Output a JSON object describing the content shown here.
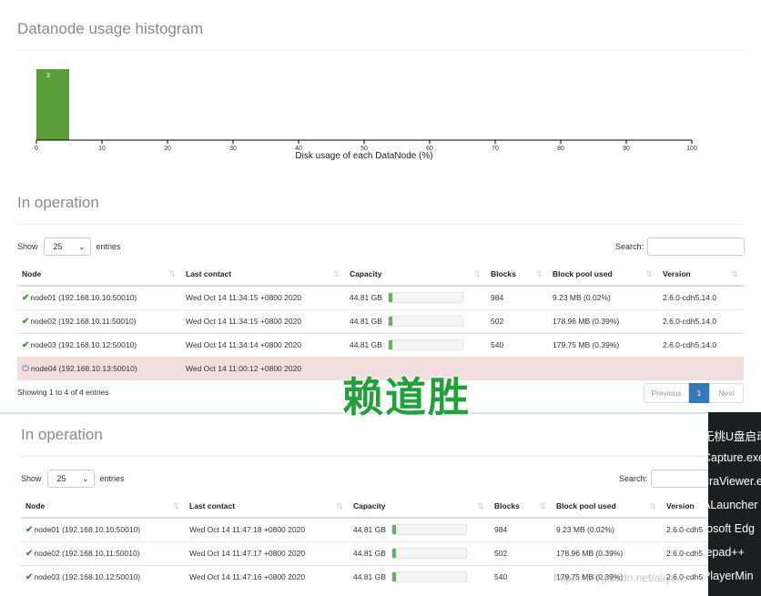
{
  "histogram": {
    "title": "Datanode usage histogram",
    "chart_data": {
      "type": "bar",
      "bins": [
        [
          0,
          5
        ]
      ],
      "values": [
        3
      ],
      "data_labels": [
        "3"
      ],
      "xlabel": "Disk usage of each DataNode (%)",
      "xlim": [
        0,
        100
      ],
      "xticks": [
        "0",
        "10",
        "20",
        "30",
        "40",
        "50",
        "60",
        "70",
        "80",
        "90",
        "100"
      ],
      "bar_color": "#5a9e3a"
    }
  },
  "section_a": {
    "title": "In operation",
    "show_label": "Show",
    "entries_value": "25",
    "entries_label": "entries",
    "search_label": "Search:",
    "columns": [
      "Node",
      "Last contact",
      "Capacity",
      "Blocks",
      "Block pool used",
      "Version"
    ],
    "rows": [
      {
        "node": "node01 (192.168.10.10:50010)",
        "contact": "Wed Oct 14 11:34:15 +0800 2020",
        "capacity": "44.81 GB",
        "used_fraction": 0.05,
        "blocks": "984",
        "pool": "9.23 MB (0.02%)",
        "version": "2.6.0-cdh5.14.0",
        "status": "ok"
      },
      {
        "node": "node02 (192.168.10.11:50010)",
        "contact": "Wed Oct 14 11:34:15 +0800 2020",
        "capacity": "44.81 GB",
        "used_fraction": 0.05,
        "blocks": "502",
        "pool": "178.96 MB (0.39%)",
        "version": "2.6.0-cdh5.14.0",
        "status": "ok"
      },
      {
        "node": "node03 (192.168.10.12:50010)",
        "contact": "Wed Oct 14 11:34:14 +0800 2020",
        "capacity": "44.81 GB",
        "used_fraction": 0.05,
        "blocks": "540",
        "pool": "179.75 MB (0.39%)",
        "version": "2.6.0-cdh5.14.0",
        "status": "ok"
      },
      {
        "node": "node04 (192.168.10.13:50010)",
        "contact": "Wed Oct 14 11:00:12 +0800 2020",
        "capacity": "",
        "used_fraction": null,
        "blocks": "",
        "pool": "",
        "version": "",
        "status": "dead"
      }
    ],
    "info": "Showing 1 to 4 of 4 entries",
    "pager": {
      "previous": "Previous",
      "current": "1",
      "next": "Next"
    }
  },
  "section_b": {
    "title": "In operation",
    "show_label": "Show",
    "entries_value": "25",
    "entries_label": "entries",
    "search_label": "Search:",
    "columns": [
      "Node",
      "Last contact",
      "Capacity",
      "Blocks",
      "Block pool used",
      "Version"
    ],
    "rows": [
      {
        "node": "node01 (192.168.10.10:50010)",
        "contact": "Wed Oct 14 11:47:18 +0800 2020",
        "capacity": "44.81 GB",
        "used_fraction": 0.05,
        "blocks": "984",
        "pool": "9.23 MB (0.02%)",
        "version": "2.6.0-cdh5",
        "status": "ok"
      },
      {
        "node": "node02 (192.168.10.11:50010)",
        "contact": "Wed Oct 14 11:47:17 +0800 2020",
        "capacity": "44.81 GB",
        "used_fraction": 0.05,
        "blocks": "502",
        "pool": "178.96 MB (0.39%)",
        "version": "2.6.0-cdh5",
        "status": "ok"
      },
      {
        "node": "node03 (192.168.10.12:50010)",
        "contact": "Wed Oct 14 11:47:16 +0800 2020",
        "capacity": "44.81 GB",
        "used_fraction": 0.05,
        "blocks": "540",
        "pool": "179.75 MB (0.39%)",
        "version": "2.6.0-cdh5",
        "status": "ok"
      }
    ]
  },
  "watermark_text": "赖道胜",
  "desktop_overlay": [
    "无桃U盘启动",
    "Capture.exe",
    "draViewer.e",
    "ALauncher",
    "rosoft Edg",
    "tepad++",
    "PlayerMin"
  ],
  "credit": "https://blog.csdn.net/aliyu..."
}
